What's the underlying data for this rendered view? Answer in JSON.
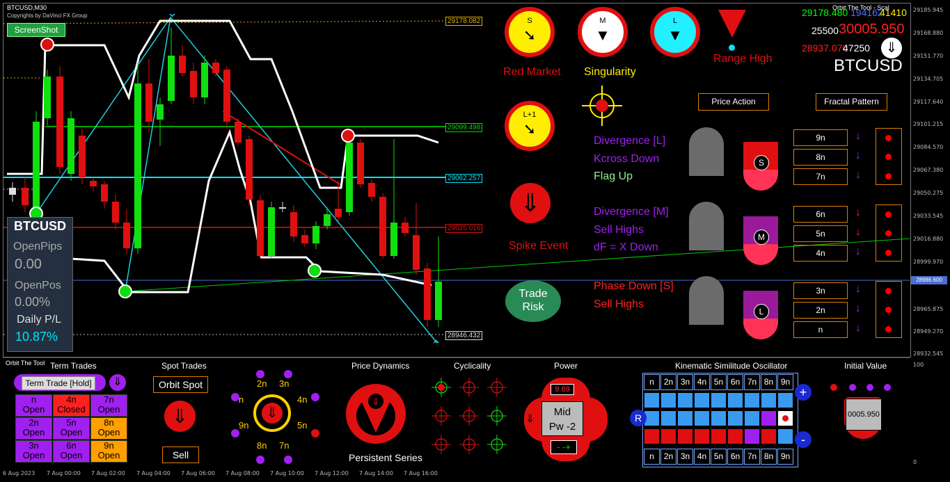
{
  "header": {
    "symbol_tf": "BTCUSD,M30",
    "copyright": "Copyrights by DaVinci FX Group",
    "screenshot_btn": "ScreenShot",
    "top_right_name": "Orbit The Tool - Scal"
  },
  "price_axis": [
    "29185.945",
    "29168.880",
    "29151.770",
    "29134.705",
    "29117.640",
    "29101.215",
    "29084.570",
    "29067.380",
    "29050.275",
    "29033.545",
    "29016.880",
    "28999.970",
    "28986.600",
    "28965.875",
    "28949.270",
    "28932.545"
  ],
  "price_labels": {
    "p1": "29178.082",
    "p2": "29099.498",
    "p3": "29062.257",
    "p4": "29025.016",
    "p5": "28946.432",
    "current": "28986.600"
  },
  "time_axis": [
    "6 Aug 2023",
    "7 Aug 00:00",
    "7 Aug 02:00",
    "7 Aug 04:00",
    "7 Aug 06:00",
    "7 Aug 08:00",
    "7 Aug 10:00",
    "7 Aug 12:00",
    "7 Aug 14:00",
    "7 Aug 16:00"
  ],
  "sub_axis": [
    "100",
    "0"
  ],
  "panel": {
    "title": "BTCUSD",
    "openpips_label": "OpenPips",
    "openpips_value": "0.00",
    "openpos_label": "OpenPos",
    "openpos_value": "0.00%",
    "daily_label": "Daily P/L",
    "daily_value": "10.87%"
  },
  "market": {
    "s_label": "S",
    "m_label": "M",
    "l_label": "L",
    "l1_label": "L+1",
    "red_market": "Red Market",
    "singularity": "Singularity",
    "range_high": "Range High",
    "spike_event": "Spike Event",
    "trade_risk": "Trade Risk",
    "price_green": "29178.480",
    "price_overlap": "194162",
    "price_yellow": "41410",
    "price_white": "25500",
    "price_red_big": "30005.950",
    "price_red_small": "28937.070",
    "price_white2": "47250",
    "symbol_big": "BTCUSD"
  },
  "buttons": {
    "price_action": "Price Action",
    "fractal_pattern": "Fractal Pattern"
  },
  "signals": {
    "group_l": [
      "Divergence [L]",
      "Kcross Down",
      "Flag Up"
    ],
    "group_m": [
      "Divergence [M]",
      "Sell Highs",
      "dF = X Down"
    ],
    "group_s": [
      "Phase Down [S]",
      "Sell Highs"
    ]
  },
  "candle_labels": {
    "s": "S",
    "m": "M",
    "l": "L"
  },
  "nlist": [
    "9n",
    "8n",
    "7n",
    "6n",
    "5n",
    "4n",
    "3n",
    "2n",
    "n"
  ],
  "bottom": {
    "orbit_tool": "Orbit The Tool",
    "term_trades": "Term Trades",
    "term_trade_hold": "Term Trade [Hold]",
    "tt_cells": [
      {
        "n": "n",
        "s": "Open",
        "c": "#a020f0"
      },
      {
        "n": "4n",
        "s": "Closed",
        "c": "#ff2020"
      },
      {
        "n": "7n",
        "s": "Open",
        "c": "#a020f0"
      },
      {
        "n": "2n",
        "s": "Open",
        "c": "#a020f0"
      },
      {
        "n": "5n",
        "s": "Open",
        "c": "#a020f0"
      },
      {
        "n": "8n",
        "s": "Open",
        "c": "#ffa000"
      },
      {
        "n": "3n",
        "s": "Open",
        "c": "#a020f0"
      },
      {
        "n": "6n",
        "s": "Open",
        "c": "#a020f0"
      },
      {
        "n": "9n",
        "s": "Open",
        "c": "#ffa000"
      }
    ],
    "spot_trades": "Spot Trades",
    "orbit_spot": "Orbit Spot",
    "sell": "Sell",
    "orbit_labels": [
      "2n",
      "3n",
      "n",
      "4n",
      "9n",
      "5n",
      "8n",
      "7n"
    ],
    "price_dynamics": "Price Dynamics",
    "persistent_series": "Persistent Series",
    "cyclicality": "Cyclicality",
    "power": "Power",
    "power_value": "9.69",
    "power_mid": "Mid",
    "power_pw": "Pw -2",
    "kso": "Kinematic Similitude Oscillator",
    "kso_top": [
      "n",
      "2n",
      "3n",
      "4n",
      "5n",
      "6n",
      "7n",
      "8n",
      "9n"
    ],
    "kso_bottom": [
      "n",
      "2n",
      "3n",
      "4n",
      "5n",
      "6n",
      "7n",
      "8n",
      "9n"
    ],
    "kso_r": "R",
    "kso_plus": "+",
    "kso_minus": "-",
    "initial_value": "Initial Value",
    "initial_value_num": "0005.950"
  }
}
